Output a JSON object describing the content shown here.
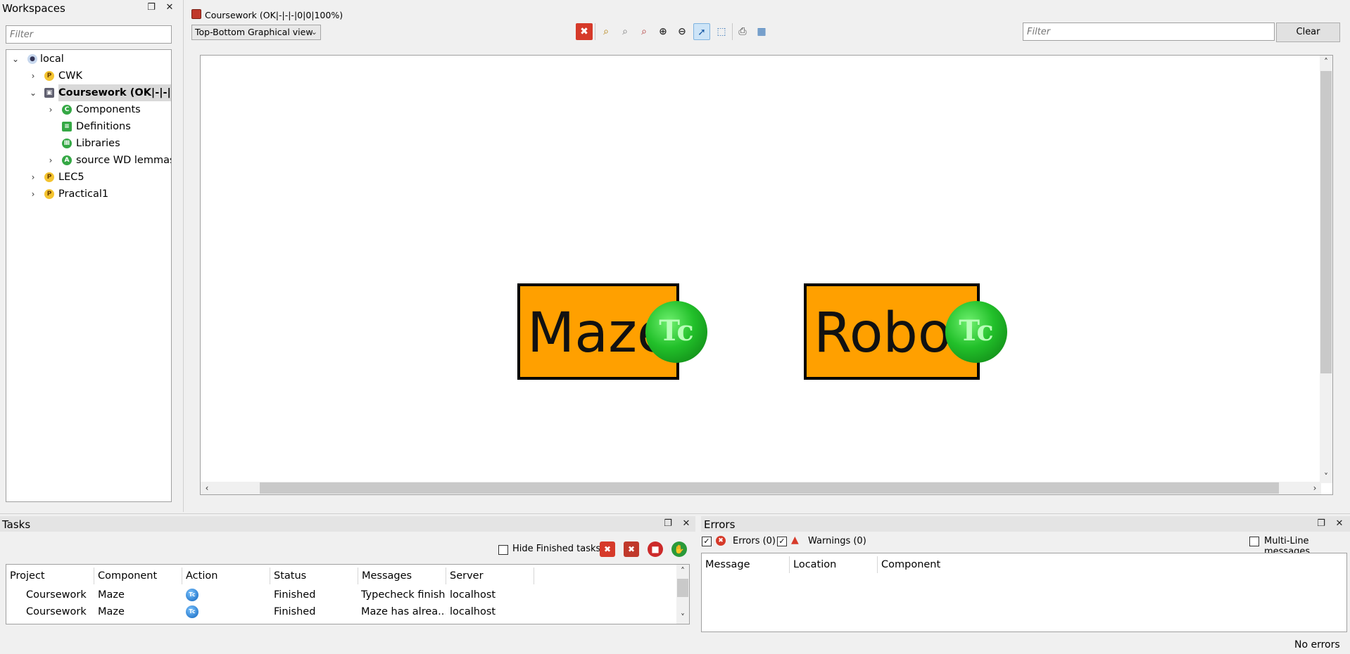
{
  "workspaces": {
    "title": "Workspaces",
    "filter_placeholder": "Filter",
    "tree": [
      {
        "label": "local",
        "icon": "server-icon",
        "expanded": true
      },
      {
        "label": "CWK",
        "icon": "project-icon"
      },
      {
        "label": "Coursework (OK|-|-|...",
        "icon": "coursework-icon",
        "expanded": true,
        "selected": true
      },
      {
        "label": "Components",
        "icon": "components-icon"
      },
      {
        "label": "Definitions",
        "icon": "definitions-icon"
      },
      {
        "label": "Libraries",
        "icon": "libraries-icon"
      },
      {
        "label": "source WD lemmas",
        "icon": "lemmas-icon"
      },
      {
        "label": "LEC5",
        "icon": "project-icon"
      },
      {
        "label": "Practical1",
        "icon": "project-icon"
      }
    ]
  },
  "editor": {
    "title": "Coursework (OK|-|-|-|0|0|100%)",
    "view_select": "Top-Bottom Graphical view",
    "filter_placeholder": "Filter",
    "clear_label": "Clear",
    "components": [
      {
        "label": "Maze",
        "badge": "Tc"
      },
      {
        "label": "Robot",
        "badge": "Tc"
      }
    ],
    "colors": {
      "component_fill": "#ffa000",
      "badge_green": "#22c02a",
      "selected_tool_bg": "#cde4f7"
    }
  },
  "tasks": {
    "title": "Tasks",
    "hide_finished_label": "Hide Finished tasks",
    "columns": [
      "Project",
      "Component",
      "Action",
      "Status",
      "Messages",
      "Server"
    ],
    "rows": [
      {
        "project": "Coursework",
        "component": "Maze",
        "action": "Tc",
        "status": "Finished",
        "messages": "Typecheck finish...",
        "server": "localhost"
      },
      {
        "project": "Coursework",
        "component": "Maze",
        "action": "Tc",
        "status": "Finished",
        "messages": "Maze has alrea...",
        "server": "localhost"
      }
    ]
  },
  "errors": {
    "title": "Errors",
    "errors_label": "Errors (0)",
    "warnings_label": "Warnings (0)",
    "multiline_label": "Multi-Line messages",
    "columns": [
      "Message",
      "Location",
      "Component"
    ],
    "status": "No errors"
  }
}
